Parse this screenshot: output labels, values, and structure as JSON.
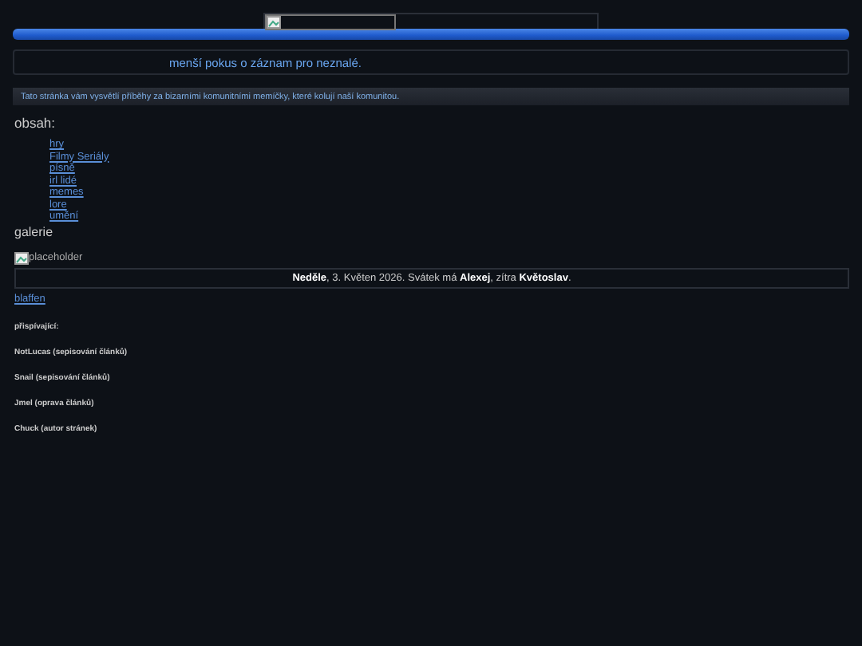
{
  "tagline": "menší pokus o záznam pro neznalé.",
  "intro": "Tato stránka vám vysvětlí příběhy za bizarními komunitními memíčky, které kolují naší komunitou.",
  "contents": {
    "heading": "obsah:",
    "links": [
      "hry",
      "Filmy Seriály",
      "písně",
      "irl lidé",
      "memes",
      "lore",
      "umění"
    ],
    "extra": "galerie"
  },
  "image_alt": "placeholder",
  "date_line": "**Neděle**, 3. Květen 2026. Svátek má **Alexej**, zítra **Květoslav**.",
  "link": "blaffen",
  "contributors_heading": "přispívající:",
  "contributors": [
    "NotLucas (sepisování článků)",
    "Snail (sepisování článků)",
    "Jmel (oprava článků)",
    "Chuck (autor stránek)"
  ]
}
